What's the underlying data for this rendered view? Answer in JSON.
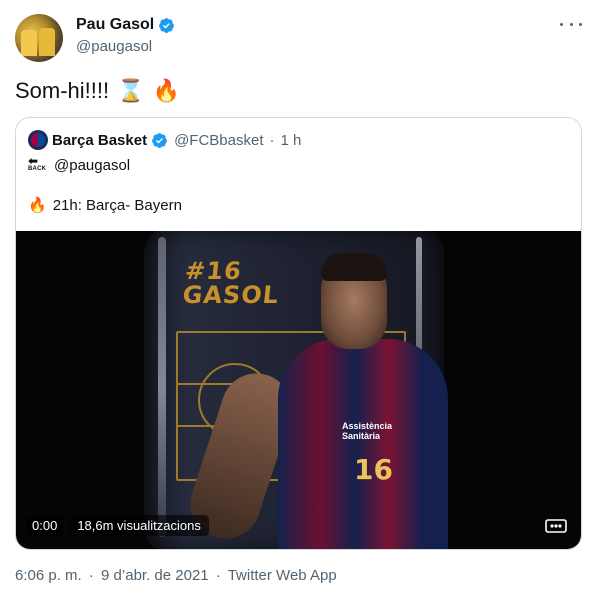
{
  "author": {
    "display_name": "Pau Gasol",
    "handle": "@paugasol",
    "verified_icon": "verified-badge-icon"
  },
  "tweet": {
    "text": "Som-hi!!!!",
    "emojis": [
      "⌛",
      "🔥"
    ]
  },
  "quoted": {
    "display_name": "Barça Basket",
    "handle": "@FCBbasket",
    "separator": "·",
    "time": "1 h",
    "back_icon_text": "BACK",
    "mention": "@paugasol",
    "fire_emoji": "🔥",
    "line": "21h: Barça- Bayern"
  },
  "video": {
    "gasol_number": "#16",
    "gasol_name": "GASOL",
    "jersey_number": "16",
    "sponsor": "Assistència\nSanitària",
    "elapsed": "0:00",
    "views": "18,6m visualitzacions"
  },
  "footer": {
    "time": "6:06 p. m.",
    "dot1": "·",
    "date": "9 d’abr. de 2021",
    "dot2": "·",
    "source": "Twitter Web App"
  },
  "colors": {
    "verified": "#1d9bf0",
    "secondary_text": "#536471",
    "border": "#cfd9de"
  }
}
